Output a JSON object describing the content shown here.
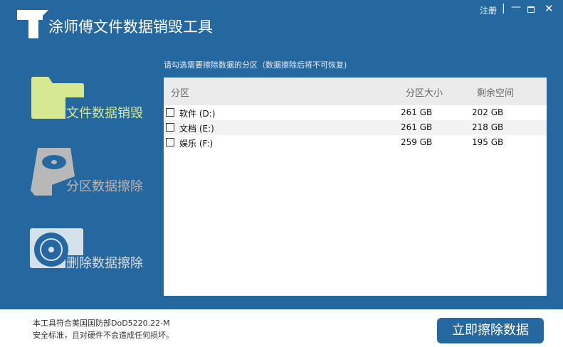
{
  "app": {
    "title": "涂师傅文件数据销毁工具",
    "register": "注册"
  },
  "sidebar": {
    "items": [
      {
        "label": "文件数据销毁",
        "color": "#d6e891"
      },
      {
        "label": "分区数据擦除",
        "color": "#b8b8b8"
      },
      {
        "label": "删除数据擦除",
        "color": "#d4e0ea"
      }
    ]
  },
  "main": {
    "hint": "请勾选需要擦除数据的分区（数据擦除后将不可恢复)",
    "columns": [
      "分区",
      "分区大小",
      "剩余空间"
    ],
    "rows": [
      {
        "name": "软件 (D:)",
        "size": "261 GB",
        "free": "202 GB",
        "checked": false
      },
      {
        "name": "文档 (E:)",
        "size": "261 GB",
        "free": "218 GB",
        "checked": false
      },
      {
        "name": "娱乐 (F:)",
        "size": "259 GB",
        "free": "195 GB",
        "checked": false
      }
    ]
  },
  "footer": {
    "line1": "本工具符合美国国防部DoD5220.22-M",
    "line2": "安全标准，且对硬件不会造成任何损坏。",
    "button": "立即擦除数据"
  }
}
